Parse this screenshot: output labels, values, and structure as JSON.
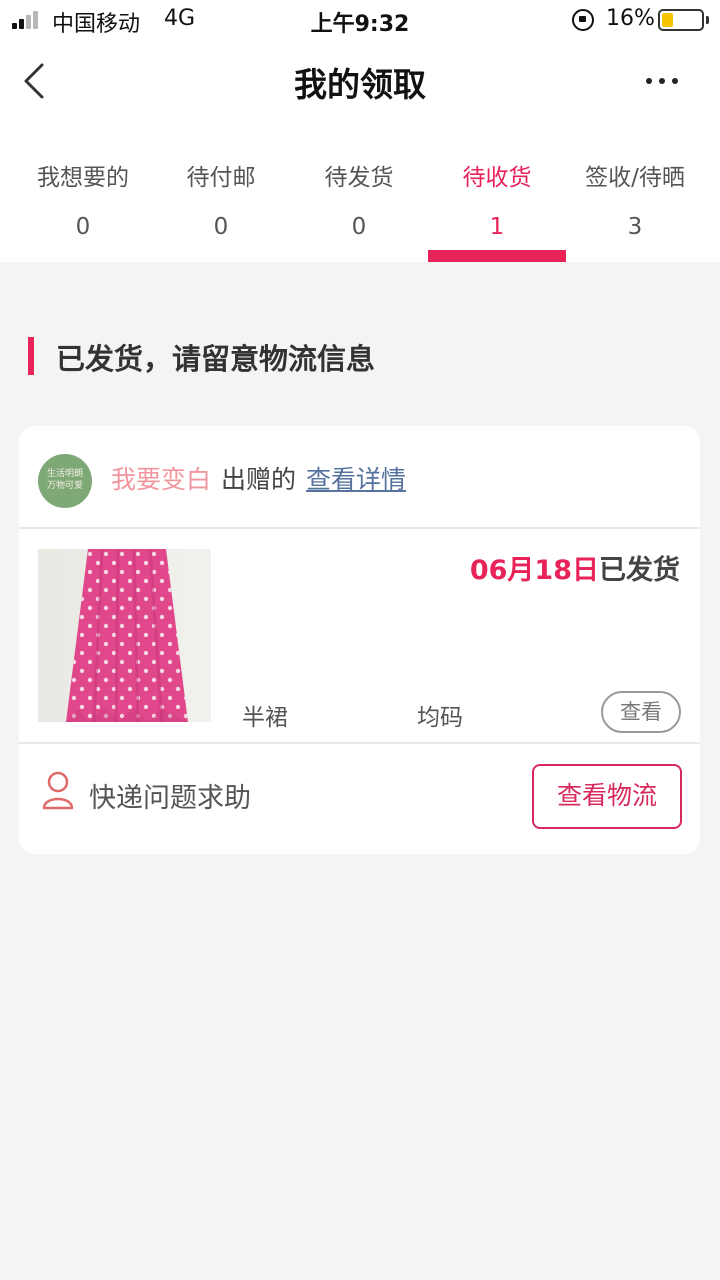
{
  "status_bar": {
    "carrier": "中国移动",
    "network": "4G",
    "time": "上午9:32",
    "battery_percent": "16%",
    "battery_level": 0.16,
    "battery_color": "#f5c400"
  },
  "nav": {
    "title": "我的领取",
    "back_icon": "chevron-left-icon",
    "more_icon": "more-dots-icon"
  },
  "tabs": [
    {
      "label": "我想要的",
      "count": "0"
    },
    {
      "label": "待付邮",
      "count": "0"
    },
    {
      "label": "待发货",
      "count": "0"
    },
    {
      "label": "待收货",
      "count": "1"
    },
    {
      "label": "签收/待晒",
      "count": "3"
    }
  ],
  "active_tab": "待收货",
  "colors": {
    "accent": "#e8235a",
    "giver_name": "#f2959d",
    "link": "#56729e",
    "background": "#f4f4f4"
  },
  "section": {
    "title": "已发货，请留意物流信息"
  },
  "order": {
    "avatar_text": [
      "生活明朗",
      "万物可爱"
    ],
    "giver_name": "我要变白",
    "giver_action": "出赠的",
    "view_detail": "查看详情",
    "ship_date": "06月18日",
    "ship_status": "已发货",
    "product_name": "半裙",
    "product_size": "均码",
    "view_button": "查看",
    "help_text": "快递问题求助",
    "help_icon": "person-icon",
    "logistics_button": "查看物流"
  }
}
